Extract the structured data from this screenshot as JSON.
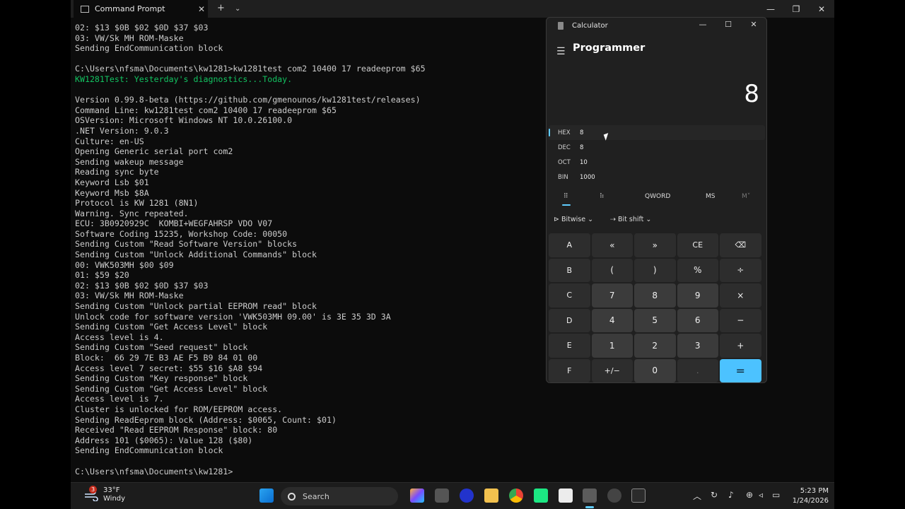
{
  "terminal": {
    "tab_title": "Command Prompt",
    "lines": [
      "02: $13 $0B $02 $0D $37 $03",
      "03: VW/Sk MH ROM-Maske",
      "Sending EndCommunication block",
      "",
      "C:\\Users\\nfsma\\Documents\\kw1281>kw1281test com2 10400 17 readeeprom $65",
      "KW1281Test: Yesterday's diagnostics...Today.",
      "",
      "Version 0.99.8-beta (https://github.com/gmenounos/kw1281test/releases)",
      "Command Line: kw1281test com2 10400 17 readeeprom $65",
      "OSVersion: Microsoft Windows NT 10.0.26100.0",
      ".NET Version: 9.0.3",
      "Culture: en-US",
      "Opening Generic serial port com2",
      "Sending wakeup message",
      "Reading sync byte",
      "Keyword Lsb $01",
      "Keyword Msb $8A",
      "Protocol is KW 1281 (8N1)",
      "Warning. Sync repeated.",
      "ECU: 3B0920929C  KOMBI+WEGFAHRSP VDO V07",
      "Software Coding 15235, Workshop Code: 00050",
      "Sending Custom \"Read Software Version\" blocks",
      "Sending Custom \"Unlock Additional Commands\" block",
      "00: VWK503MH $00 $09",
      "01: $59 $20",
      "02: $13 $0B $02 $0D $37 $03",
      "03: VW/Sk MH ROM-Maske",
      "Sending Custom \"Unlock partial EEPROM read\" block",
      "Unlock code for software version 'VWK503MH 09.00' is 3E 35 3D 3A",
      "Sending Custom \"Get Access Level\" block",
      "Access level is 4.",
      "Sending Custom \"Seed request\" block",
      "Block:  66 29 7E B3 AE F5 B9 84 01 00",
      "Access level 7 secret: $55 $16 $A8 $94",
      "Sending Custom \"Key response\" block",
      "Sending Custom \"Get Access Level\" block",
      "Access level is 7.",
      "Cluster is unlocked for ROM/EEPROM access.",
      "Sending ReadEeprom block (Address: $0065, Count: $01)",
      "Received \"Read EEPROM Response\" block: 80",
      "Address 101 ($0065): Value 128 ($80)",
      "Sending EndCommunication block",
      "",
      "C:\\Users\\nfsma\\Documents\\kw1281>"
    ],
    "green_line_index": 5
  },
  "calculator": {
    "title": "Calculator",
    "mode": "Programmer",
    "display": "8",
    "radix": [
      {
        "name": "HEX",
        "value": "8"
      },
      {
        "name": "DEC",
        "value": "8"
      },
      {
        "name": "OCT",
        "value": "10"
      },
      {
        "name": "BIN",
        "value": "1000"
      }
    ],
    "word_size": "QWORD",
    "ms": "MS",
    "mdrop": "M˅",
    "bitwise": "Bitwise",
    "bitshift": "Bit shift",
    "keys": [
      "A",
      "«",
      "»",
      "CE",
      "⌫",
      "B",
      "(",
      ")",
      "%",
      "÷",
      "C",
      "7",
      "8",
      "9",
      "×",
      "D",
      "4",
      "5",
      "6",
      "−",
      "E",
      "1",
      "2",
      "3",
      "+",
      "F",
      "+/−",
      "0",
      ".",
      "="
    ]
  },
  "taskbar": {
    "temp": "33°F",
    "condition": "Windy",
    "badge": "3",
    "search_placeholder": "Search",
    "time": "5:23 PM",
    "date": "1/24/2026"
  },
  "colors": {
    "accent": "#4cc2ff",
    "terminal_green": "#13c261"
  }
}
